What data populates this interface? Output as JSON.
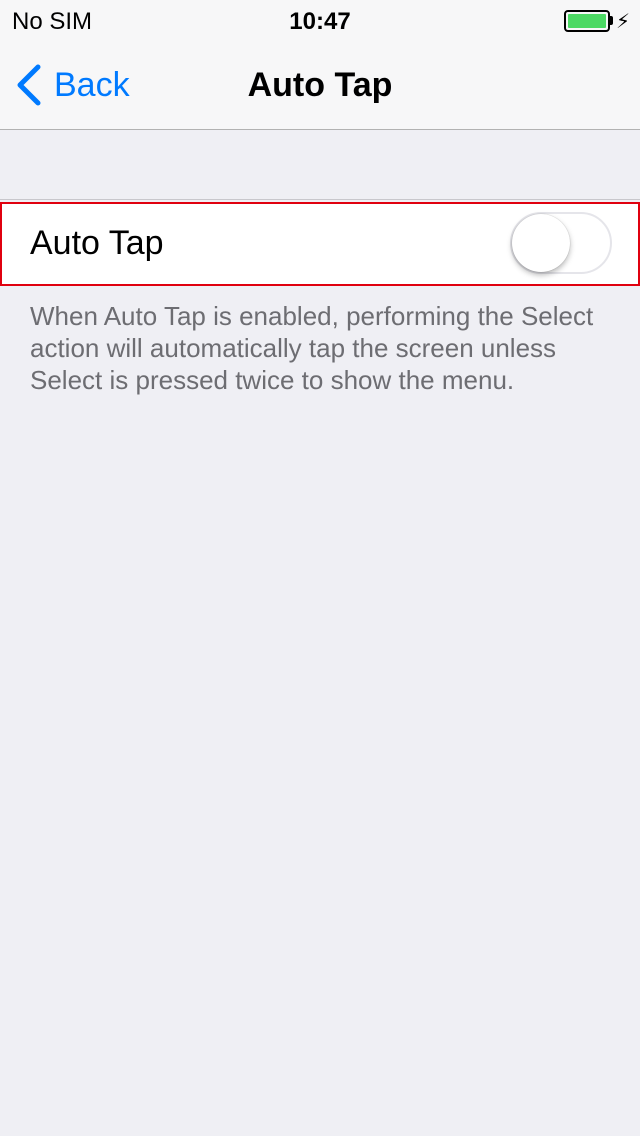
{
  "status_bar": {
    "carrier": "No SIM",
    "time": "10:47",
    "battery_color": "#4cd964"
  },
  "nav": {
    "back_label": "Back",
    "title": "Auto Tap"
  },
  "setting": {
    "label": "Auto Tap",
    "enabled": false,
    "highlight_color": "#e0000f"
  },
  "footer": {
    "text": "When Auto Tap is enabled, performing the Select action will automatically tap the screen unless Select is pressed twice to show the menu."
  },
  "colors": {
    "accent": "#007aff",
    "background": "#efeff4"
  }
}
